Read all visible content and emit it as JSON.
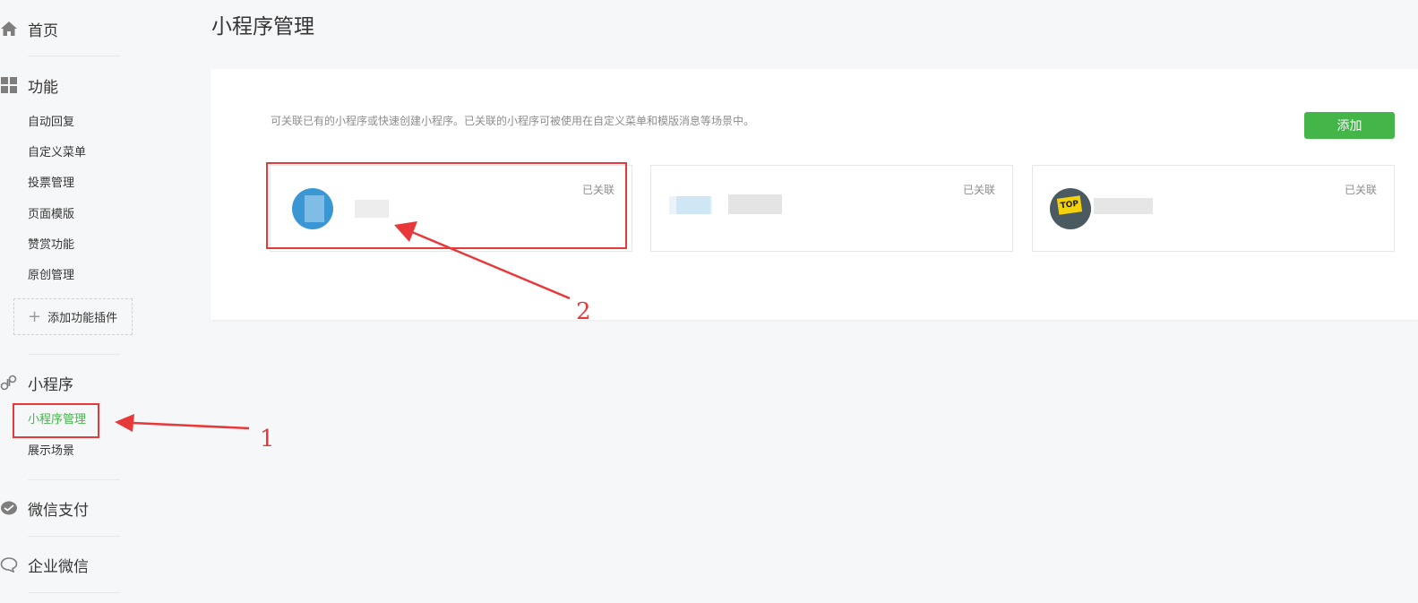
{
  "sidebar": {
    "home": {
      "label": "首页",
      "icon": "home-icon"
    },
    "features": {
      "label": "功能",
      "icon": "grid-icon",
      "items": [
        "自动回复",
        "自定义菜单",
        "投票管理",
        "页面模版",
        "赞赏功能",
        "原创管理"
      ],
      "add_plugin": "添加功能插件"
    },
    "miniprogram": {
      "label": "小程序",
      "icon": "link-icon",
      "items": [
        "小程序管理",
        "展示场景"
      ],
      "active_index": 0
    },
    "wechat_pay": {
      "label": "微信支付",
      "icon": "wechat-pay-icon"
    },
    "work_wechat": {
      "label": "企业微信",
      "icon": "chat-bubble-icon"
    }
  },
  "main": {
    "title": "小程序管理",
    "description": "可关联已有的小程序或快速创建小程序。已关联的小程序可被使用在自定义菜单和模版消息等场景中。",
    "add_button": "添加",
    "cards": [
      {
        "status": "已关联"
      },
      {
        "status": "已关联"
      },
      {
        "status": "已关联",
        "badge": "TOP"
      }
    ]
  },
  "annotations": {
    "step1": "1",
    "step2": "2"
  },
  "colors": {
    "accent": "#44b549",
    "annotation": "#e8393a"
  }
}
